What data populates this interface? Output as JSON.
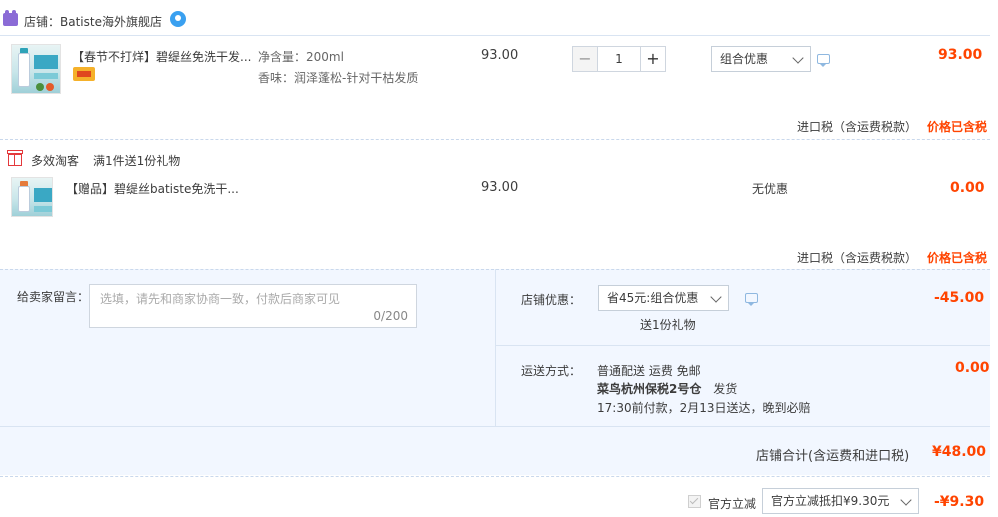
{
  "shop": {
    "label": "店铺：",
    "name": "Batiste海外旗舰店"
  },
  "item1": {
    "title": "【春节不打烊】碧缇丝免洗干发...",
    "sku_size": "净含量：200ml",
    "sku_scent": "香味：润泽蓬松-针对干枯发质",
    "unit_price": "93.00",
    "qty_minus": "−",
    "qty_plus": "+",
    "qty_value": "1",
    "promo_select": "组合优惠",
    "total": "93.00"
  },
  "tax1": {
    "label": "进口税（含运费税款）",
    "value": "价格已含税"
  },
  "promo_group": {
    "title": "多效淘客",
    "rule": "满1件送1份礼物"
  },
  "gift": {
    "title": "【赠品】碧缇丝batiste免洗干...",
    "unit_price": "93.00",
    "promo": "无优惠",
    "total": "0.00"
  },
  "tax2": {
    "label": "进口税（含运费税款）",
    "value": "价格已含税"
  },
  "message": {
    "label": "给卖家留言：",
    "placeholder": "选填，请先和商家协商一致，付款后商家可见",
    "counter": "0/200"
  },
  "shop_discount": {
    "label": "店铺优惠：",
    "select": "省45元:组合优惠",
    "sub": "送1份礼物",
    "amount": "-45.00"
  },
  "shipping": {
    "label": "运送方式：",
    "method": "普通配送 运费 免邮",
    "warehouse": "菜鸟杭州保税2号仓",
    "ship_word": "发货",
    "eta": "17:30前付款，2月13日送达，晚到必赔",
    "amount": "0.00"
  },
  "shop_total": {
    "label": "店铺合计(含运费和进口税)",
    "amount": "¥48.00"
  },
  "official": {
    "checkbox_label": "官方立减",
    "select": "官方立减抵扣¥9.30元",
    "amount": "-¥9.30"
  },
  "colors": {
    "accent_red": "#ff4400",
    "panel_bg": "#f2f7ff",
    "divider": "#c9d8ec"
  }
}
